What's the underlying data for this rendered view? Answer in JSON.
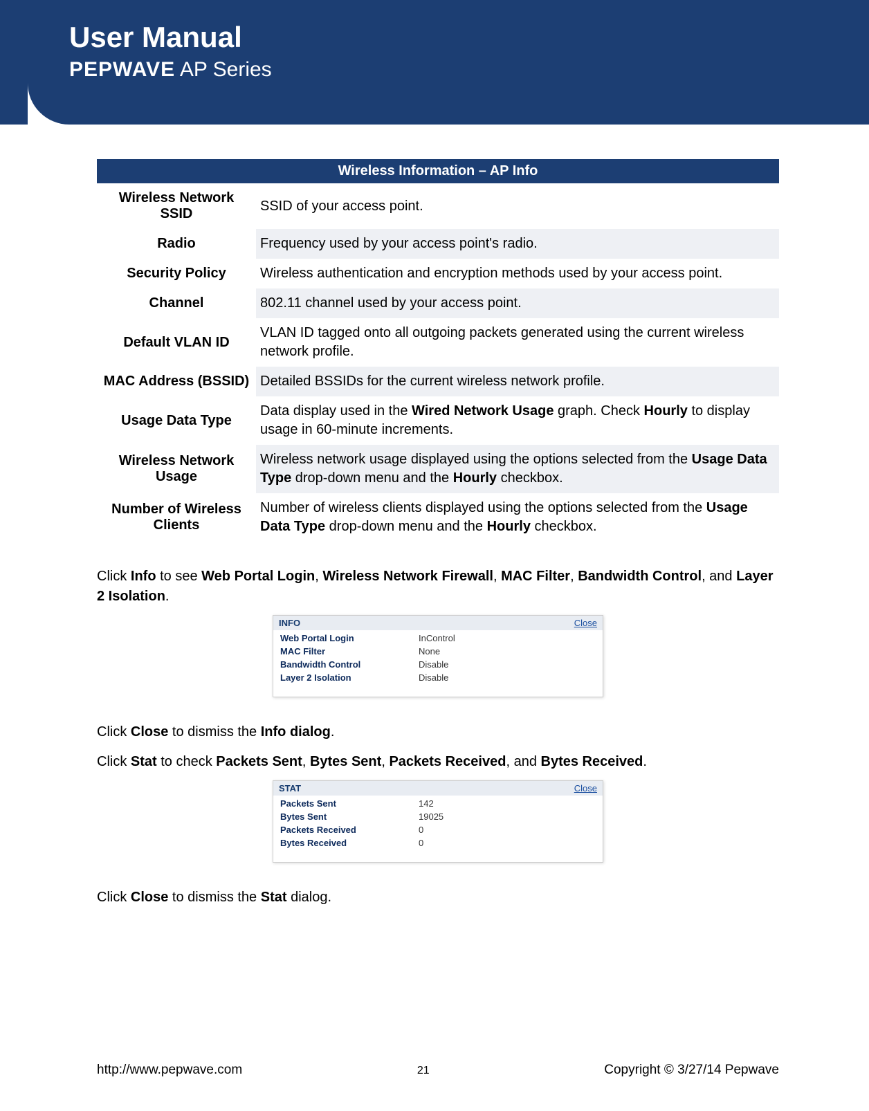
{
  "header": {
    "title": "User Manual",
    "brand_strong": "PEPWAVE",
    "brand_light": " AP Series"
  },
  "table": {
    "title": "Wireless Information – AP Info",
    "rows": [
      {
        "label": "Wireless Network SSID",
        "desc": "SSID of your access point."
      },
      {
        "label": "Radio",
        "desc": "Frequency used by your access point's radio."
      },
      {
        "label": "Security Policy",
        "desc": "Wireless authentication and encryption methods used by your access point."
      },
      {
        "label": "Channel",
        "desc": "802.11 channel used by your access point."
      },
      {
        "label": "Default VLAN ID",
        "desc": "VLAN ID tagged onto all outgoing packets generated using the current wireless network profile."
      },
      {
        "label": "MAC Address (BSSID)",
        "desc": "Detailed BSSIDs for the current wireless network profile."
      },
      {
        "label": "Usage Data Type",
        "desc_html": "Data display used in the <b>Wired Network Usage</b> graph. Check <b>Hourly</b> to display usage in 60-minute increments."
      },
      {
        "label": "Wireless Network Usage",
        "desc_html": "Wireless network usage displayed using the options selected from the <b>Usage Data Type</b> drop-down menu and the <b>Hourly</b> checkbox."
      },
      {
        "label": "Number of Wireless Clients",
        "desc_html": "Number of wireless clients displayed using the options selected from the <b>Usage Data Type</b> drop-down menu and the <b>Hourly</b> checkbox."
      }
    ]
  },
  "paragraphs": {
    "p1_html": "Click <b>Info</b> to see <b>Web Portal Login</b>, <b>Wireless Network Firewall</b>, <b>MAC Filter</b>, <b>Bandwidth Control</b>, and <b>Layer 2 Isolation</b>.",
    "p2_html": "Click <b>Close</b> to dismiss the <b>Info dialog</b>.",
    "p3_html": "Click <b>Stat</b> to check <b>Packets Sent</b>, <b>Bytes Sent</b>, <b>Packets Received</b>, and <b>Bytes Received</b>.",
    "p4_html": "Click <b>Close</b> to dismiss the <b>Stat</b> dialog."
  },
  "info_dialog": {
    "title": "INFO",
    "close": "Close",
    "rows": [
      {
        "k": "Web Portal Login",
        "v": "InControl"
      },
      {
        "k": "MAC Filter",
        "v": "None"
      },
      {
        "k": "Bandwidth Control",
        "v": "Disable"
      },
      {
        "k": "Layer 2 Isolation",
        "v": "Disable"
      }
    ]
  },
  "stat_dialog": {
    "title": "STAT",
    "close": "Close",
    "rows": [
      {
        "k": "Packets Sent",
        "v": "142"
      },
      {
        "k": "Bytes Sent",
        "v": "19025"
      },
      {
        "k": "Packets Received",
        "v": "0"
      },
      {
        "k": "Bytes Received",
        "v": "0"
      }
    ]
  },
  "footer": {
    "url": "http://www.pepwave.com",
    "page": "21",
    "copyright": "Copyright © 3/27/14 Pepwave"
  }
}
